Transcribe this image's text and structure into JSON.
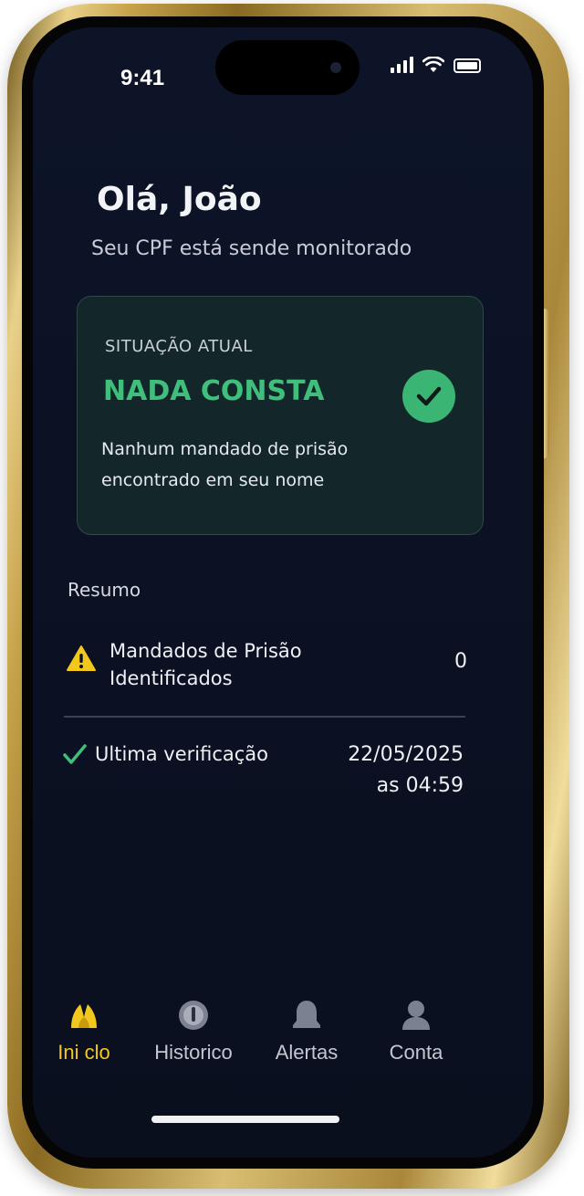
{
  "status_bar": {
    "time": "9:41"
  },
  "header": {
    "greeting": "Olá, João",
    "subtitle": "Seu CPF está sende monitorado"
  },
  "status_card": {
    "label": "SITUAÇÃO ATUAL",
    "status": "NADA CONSTA",
    "description": "Nanhum mandado de prisão encontrado em seu nome",
    "accent_color": "#3bb574",
    "icon": "check-circle-icon"
  },
  "summary": {
    "title": "Resumo",
    "warrants": {
      "label": "Mandados de Prisão Identificados",
      "value": "0",
      "icon": "warning-icon"
    },
    "last_check": {
      "label": "Ultima verificação",
      "date": "22/05/2025",
      "time": "as 04:59",
      "icon": "check-icon"
    }
  },
  "tabs": [
    {
      "label": "Ini clo",
      "icon": "home-icon",
      "active": true
    },
    {
      "label": "Historico",
      "icon": "history-icon",
      "active": false
    },
    {
      "label": "Alertas",
      "icon": "bell-icon",
      "active": false
    },
    {
      "label": "Conta",
      "icon": "user-icon",
      "active": false
    }
  ],
  "colors": {
    "background": "#0b1122",
    "active_tab": "#f3c81d",
    "success": "#3fbf7b"
  }
}
